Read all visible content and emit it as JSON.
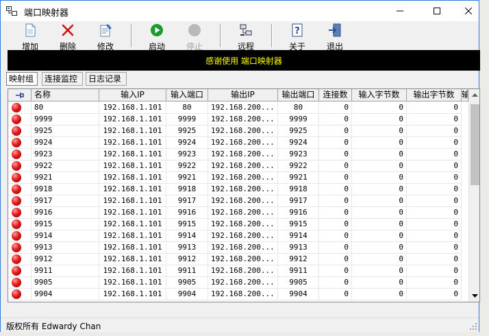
{
  "window": {
    "title": "端口映射器"
  },
  "toolbar": {
    "add": "增加",
    "delete": "删除",
    "edit": "修改",
    "start": "启动",
    "stop": "停止",
    "remote": "远程",
    "about": "关于",
    "exit": "退出"
  },
  "banner": {
    "text": "感谢使用 端口映射器"
  },
  "tabs": [
    "映射组",
    "连接监控",
    "日志记录"
  ],
  "grid": {
    "columns": [
      "",
      "名称",
      "输入IP",
      "输入端口",
      "输出IP",
      "输出端口",
      "连接数",
      "输入字节数",
      "输出字节数",
      "输"
    ],
    "rows": [
      [
        "80",
        "192.168.1.101",
        "80",
        "192.168.200...",
        "80",
        "0",
        "0",
        "0"
      ],
      [
        "9999",
        "192.168.1.101",
        "9999",
        "192.168.200...",
        "9999",
        "0",
        "0",
        "0"
      ],
      [
        "9925",
        "192.168.1.101",
        "9925",
        "192.168.200...",
        "9925",
        "0",
        "0",
        "0"
      ],
      [
        "9924",
        "192.168.1.101",
        "9924",
        "192.168.200...",
        "9924",
        "0",
        "0",
        "0"
      ],
      [
        "9923",
        "192.168.1.101",
        "9923",
        "192.168.200...",
        "9923",
        "0",
        "0",
        "0"
      ],
      [
        "9922",
        "192.168.1.101",
        "9922",
        "192.168.200...",
        "9922",
        "0",
        "0",
        "0"
      ],
      [
        "9921",
        "192.168.1.101",
        "9921",
        "192.168.200...",
        "9921",
        "0",
        "0",
        "0"
      ],
      [
        "9918",
        "192.168.1.101",
        "9918",
        "192.168.200...",
        "9918",
        "0",
        "0",
        "0"
      ],
      [
        "9917",
        "192.168.1.101",
        "9917",
        "192.168.200...",
        "9917",
        "0",
        "0",
        "0"
      ],
      [
        "9916",
        "192.168.1.101",
        "9916",
        "192.168.200...",
        "9916",
        "0",
        "0",
        "0"
      ],
      [
        "9915",
        "192.168.1.101",
        "9915",
        "192.168.200...",
        "9915",
        "0",
        "0",
        "0"
      ],
      [
        "9914",
        "192.168.1.101",
        "9914",
        "192.168.200...",
        "9914",
        "0",
        "0",
        "0"
      ],
      [
        "9913",
        "192.168.1.101",
        "9913",
        "192.168.200...",
        "9913",
        "0",
        "0",
        "0"
      ],
      [
        "9912",
        "192.168.1.101",
        "9912",
        "192.168.200...",
        "9912",
        "0",
        "0",
        "0"
      ],
      [
        "9911",
        "192.168.1.101",
        "9911",
        "192.168.200...",
        "9911",
        "0",
        "0",
        "0"
      ],
      [
        "9905",
        "192.168.1.101",
        "9905",
        "192.168.200...",
        "9905",
        "0",
        "0",
        "0"
      ],
      [
        "9904",
        "192.168.1.101",
        "9904",
        "192.168.200...",
        "9904",
        "0",
        "0",
        "0"
      ]
    ]
  },
  "status": {
    "text": "版权所有 Edwardy Chan"
  },
  "colors": {
    "banner_bg": "#000000",
    "banner_text": "#ffff00",
    "status_dot": "#e31b1b"
  }
}
